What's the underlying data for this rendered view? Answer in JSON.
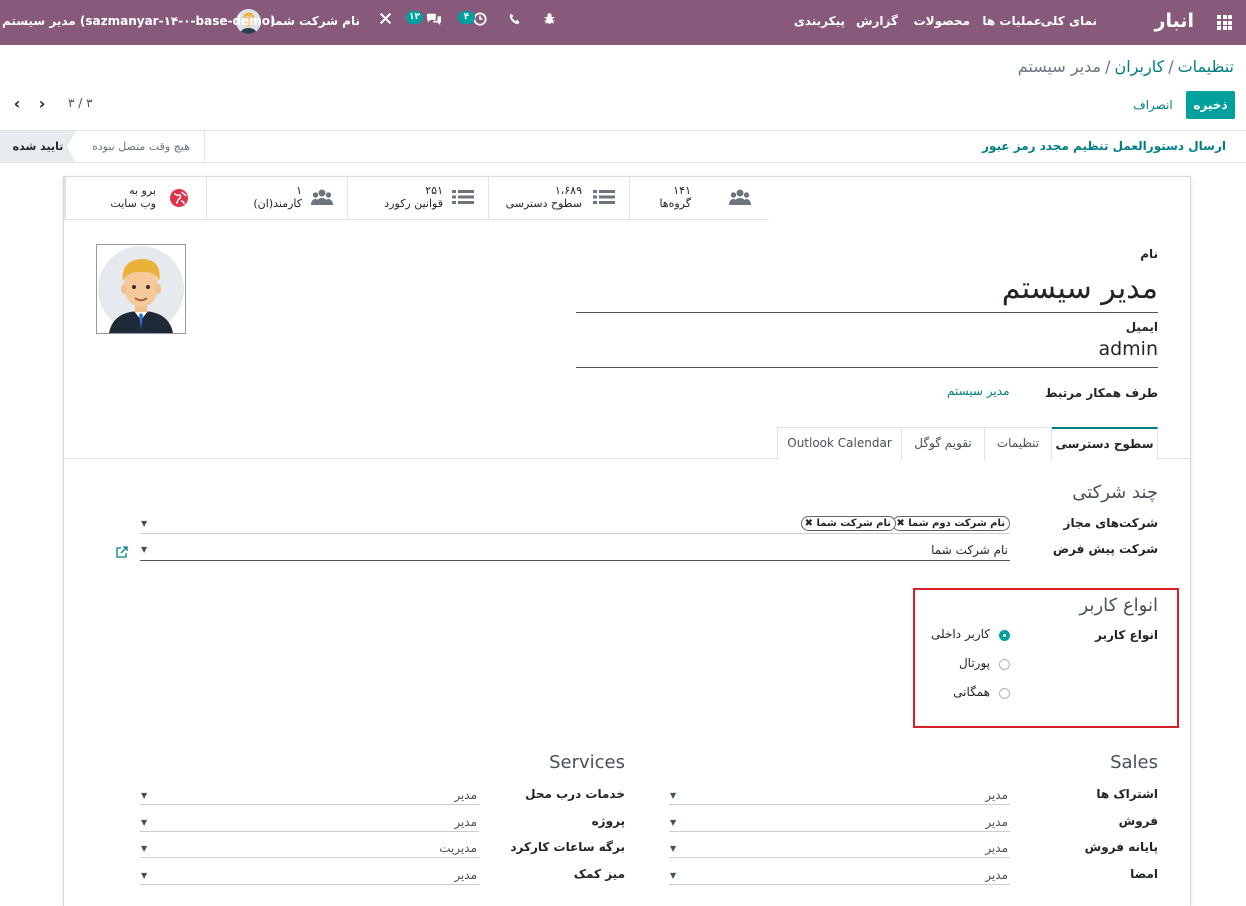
{
  "navbar": {
    "brand": "انبار",
    "menu": [
      "نمای کلی",
      "عملیات ها",
      "محصولات",
      "گزارش",
      "پیکربندی"
    ],
    "activity_badge": "۴",
    "messages_badge": "۱۳",
    "company_name": "نام شرکت شما",
    "user_name": "مدیر سیستم (sazmanyar-۱۴-۰-base-demo)"
  },
  "breadcrumb": {
    "items": [
      "تنظیمات",
      "کاربران"
    ],
    "current": "مدیر سیستم"
  },
  "buttons": {
    "save": "ذخیره",
    "discard": "انصراف"
  },
  "pager": {
    "value": "۳ / ۳"
  },
  "statusbar": {
    "reset_password": "ارسال دستورالعمل تنظیم مجدد رمز عبور",
    "status_active": "تایید شده",
    "status_other": "هیچ وقت متصل نبوده"
  },
  "smart_buttons": [
    {
      "value": "۱۴۱",
      "label": "گروه‌ها",
      "icon": "users-icon"
    },
    {
      "value": "۱،۶۸۹",
      "label": "سطوح دسترسی",
      "icon": "list-icon"
    },
    {
      "value": "۲۵۱",
      "label": "قوانین رکورد",
      "icon": "list-icon"
    },
    {
      "value": "۱",
      "label": "کارمند(ان)",
      "icon": "users-icon"
    },
    {
      "value": "برو به",
      "label": "وب سایت",
      "icon": "globe-icon"
    }
  ],
  "form": {
    "name_label": "نام",
    "name_value": "مدیر سیستم",
    "email_label": "ایمیل",
    "email_value": "admin",
    "partner_label": "طرف همکار مرتبط",
    "partner_value": "مدیر سیستم"
  },
  "tabs": [
    "سطوح دسترسی",
    "تنظیمات",
    "تقویم گوگل",
    "Outlook Calendar"
  ],
  "multi_company": {
    "title": "چند شرکتی",
    "allowed_label": "شرکت‌های مجاز",
    "allowed_tags": [
      "نام شرکت دوم شما",
      "نام شرکت شما"
    ],
    "default_label": "شرکت پیش فرض",
    "default_value": "نام شرکت شما"
  },
  "user_types": {
    "title": "انواع کاربر",
    "label": "انواع کاربر",
    "options": [
      {
        "label": "کاربر داخلی",
        "selected": true
      },
      {
        "label": "پورتال",
        "selected": false
      },
      {
        "label": "همگانی",
        "selected": false
      }
    ]
  },
  "sales": {
    "title": "Sales",
    "rows": [
      {
        "label": "اشتراک ها",
        "value": "مدیر"
      },
      {
        "label": "فروش",
        "value": "مدیر"
      },
      {
        "label": "پایانه فروش",
        "value": "مدیر"
      },
      {
        "label": "امضا",
        "value": "مدیر"
      }
    ]
  },
  "services": {
    "title": "Services",
    "rows": [
      {
        "label": "خدمات درب محل",
        "value": "مدیر"
      },
      {
        "label": "پروژه",
        "value": "مدیر"
      },
      {
        "label": "برگه ساعات کارکرد",
        "value": "مدیریت"
      },
      {
        "label": "میز کمک",
        "value": "مدیر"
      }
    ]
  },
  "colors": {
    "navbar": "#875a7b",
    "primary": "#00a09d",
    "link": "#017e84",
    "highlight": "#d8202a"
  }
}
